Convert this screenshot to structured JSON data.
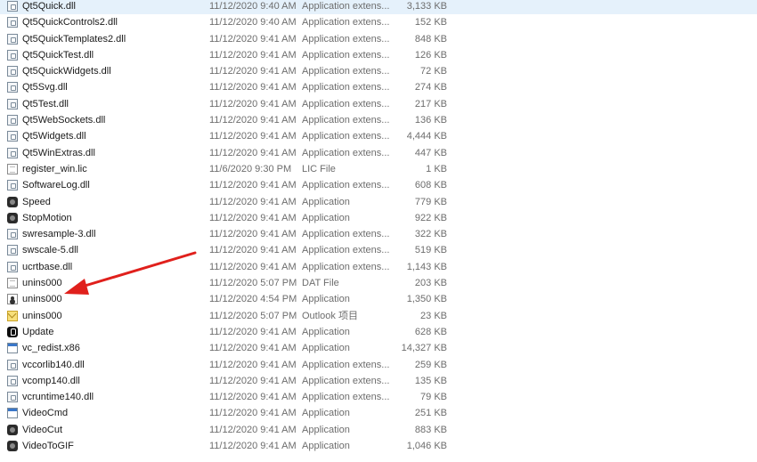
{
  "files": [
    {
      "name": "Qt5Quick.dll",
      "date": "11/12/2020 9:40 AM",
      "type": "Application extens...",
      "size": "3,133 KB",
      "icon": "dll-icon"
    },
    {
      "name": "Qt5QuickControls2.dll",
      "date": "11/12/2020 9:40 AM",
      "type": "Application extens...",
      "size": "152 KB",
      "icon": "dll-icon"
    },
    {
      "name": "Qt5QuickTemplates2.dll",
      "date": "11/12/2020 9:41 AM",
      "type": "Application extens...",
      "size": "848 KB",
      "icon": "dll-icon"
    },
    {
      "name": "Qt5QuickTest.dll",
      "date": "11/12/2020 9:41 AM",
      "type": "Application extens...",
      "size": "126 KB",
      "icon": "dll-icon"
    },
    {
      "name": "Qt5QuickWidgets.dll",
      "date": "11/12/2020 9:41 AM",
      "type": "Application extens...",
      "size": "72 KB",
      "icon": "dll-icon"
    },
    {
      "name": "Qt5Svg.dll",
      "date": "11/12/2020 9:41 AM",
      "type": "Application extens...",
      "size": "274 KB",
      "icon": "dll-icon"
    },
    {
      "name": "Qt5Test.dll",
      "date": "11/12/2020 9:41 AM",
      "type": "Application extens...",
      "size": "217 KB",
      "icon": "dll-icon"
    },
    {
      "name": "Qt5WebSockets.dll",
      "date": "11/12/2020 9:41 AM",
      "type": "Application extens...",
      "size": "136 KB",
      "icon": "dll-icon"
    },
    {
      "name": "Qt5Widgets.dll",
      "date": "11/12/2020 9:41 AM",
      "type": "Application extens...",
      "size": "4,444 KB",
      "icon": "dll-icon"
    },
    {
      "name": "Qt5WinExtras.dll",
      "date": "11/12/2020 9:41 AM",
      "type": "Application extens...",
      "size": "447 KB",
      "icon": "dll-icon"
    },
    {
      "name": "register_win.lic",
      "date": "11/6/2020 9:30 PM",
      "type": "LIC File",
      "size": "1 KB",
      "icon": "document-icon"
    },
    {
      "name": "SoftwareLog.dll",
      "date": "11/12/2020 9:41 AM",
      "type": "Application extens...",
      "size": "608 KB",
      "icon": "dll-icon"
    },
    {
      "name": "Speed",
      "date": "11/12/2020 9:41 AM",
      "type": "Application",
      "size": "779 KB",
      "icon": "app-dark-icon"
    },
    {
      "name": "StopMotion",
      "date": "11/12/2020 9:41 AM",
      "type": "Application",
      "size": "922 KB",
      "icon": "app-dark-icon"
    },
    {
      "name": "swresample-3.dll",
      "date": "11/12/2020 9:41 AM",
      "type": "Application extens...",
      "size": "322 KB",
      "icon": "dll-icon"
    },
    {
      "name": "swscale-5.dll",
      "date": "11/12/2020 9:41 AM",
      "type": "Application extens...",
      "size": "519 KB",
      "icon": "dll-icon"
    },
    {
      "name": "ucrtbase.dll",
      "date": "11/12/2020 9:41 AM",
      "type": "Application extens...",
      "size": "1,143 KB",
      "icon": "dll-icon"
    },
    {
      "name": "unins000",
      "date": "11/12/2020 5:07 PM",
      "type": "DAT File",
      "size": "203 KB",
      "icon": "document-icon"
    },
    {
      "name": "unins000",
      "date": "11/12/2020 4:54 PM",
      "type": "Application",
      "size": "1,350 KB",
      "icon": "installer-icon"
    },
    {
      "name": "unins000",
      "date": "11/12/2020 5:07 PM",
      "type": "Outlook 项目",
      "size": "23 KB",
      "icon": "mail-icon"
    },
    {
      "name": "Update",
      "date": "11/12/2020 9:41 AM",
      "type": "Application",
      "size": "628 KB",
      "icon": "app-black-icon"
    },
    {
      "name": "vc_redist.x86",
      "date": "11/12/2020 9:41 AM",
      "type": "Application",
      "size": "14,327 KB",
      "icon": "app-window-icon"
    },
    {
      "name": "vccorlib140.dll",
      "date": "11/12/2020 9:41 AM",
      "type": "Application extens...",
      "size": "259 KB",
      "icon": "dll-icon"
    },
    {
      "name": "vcomp140.dll",
      "date": "11/12/2020 9:41 AM",
      "type": "Application extens...",
      "size": "135 KB",
      "icon": "dll-icon"
    },
    {
      "name": "vcruntime140.dll",
      "date": "11/12/2020 9:41 AM",
      "type": "Application extens...",
      "size": "79 KB",
      "icon": "dll-icon"
    },
    {
      "name": "VideoCmd",
      "date": "11/12/2020 9:41 AM",
      "type": "Application",
      "size": "251 KB",
      "icon": "app-window-icon"
    },
    {
      "name": "VideoCut",
      "date": "11/12/2020 9:41 AM",
      "type": "Application",
      "size": "883 KB",
      "icon": "app-dark-icon"
    },
    {
      "name": "VideoToGIF",
      "date": "11/12/2020 9:41 AM",
      "type": "Application",
      "size": "1,046 KB",
      "icon": "app-dark-icon"
    }
  ],
  "colors": {
    "arrow": "#e0201c",
    "row_hover": "#e5f1fb",
    "secondary_text": "#6d6d6d"
  },
  "annotation": {
    "type": "red-arrow",
    "points_to_row": 18
  }
}
